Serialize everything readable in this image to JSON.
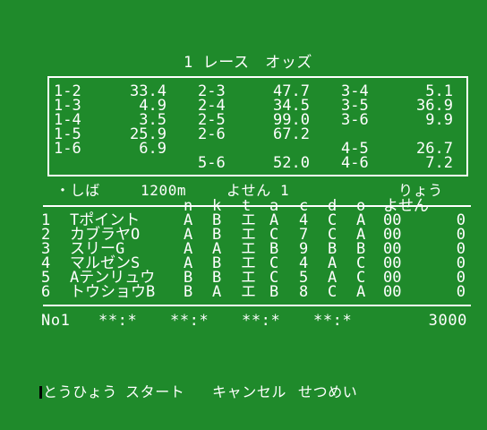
{
  "title": "1 レース　オッズ",
  "odds": {
    "col1": [
      {
        "pair": "1-2",
        "odds": "33.4"
      },
      {
        "pair": "1-3",
        "odds": "4.9"
      },
      {
        "pair": "1-4",
        "odds": "3.5"
      },
      {
        "pair": "1-5",
        "odds": "25.9"
      },
      {
        "pair": "1-6",
        "odds": "6.9"
      }
    ],
    "col2": [
      {
        "pair": "2-3",
        "odds": "47.7"
      },
      {
        "pair": "2-4",
        "odds": "34.5"
      },
      {
        "pair": "2-5",
        "odds": "99.0"
      },
      {
        "pair": "2-6",
        "odds": "67.2"
      },
      {
        "pair": "5-6",
        "odds": "52.0"
      }
    ],
    "col3": [
      {
        "pair": "3-4",
        "odds": "5.1"
      },
      {
        "pair": "3-5",
        "odds": "36.9"
      },
      {
        "pair": "3-6",
        "odds": "9.9"
      },
      {
        "pair": "4-5",
        "odds": "26.7"
      },
      {
        "pair": "4-6",
        "odds": "7.2"
      }
    ]
  },
  "race_info": {
    "surface": "・しば",
    "distance": "1200m",
    "type": "よせん 1",
    "right_label": "りょう"
  },
  "headers": [
    "n",
    "k",
    "t",
    "a",
    "c",
    "d",
    "o",
    "よせん"
  ],
  "horses": [
    {
      "no": "1",
      "name": "Tポイント",
      "n": "A",
      "k": "B",
      "t": "エ",
      "a": "A",
      "c": "4",
      "d": "C",
      "o": "A",
      "y": "00",
      "r": "0"
    },
    {
      "no": "2",
      "name": "カブラヤO",
      "n": "A",
      "k": "B",
      "t": "エ",
      "a": "C",
      "c": "7",
      "d": "C",
      "o": "A",
      "y": "00",
      "r": "0"
    },
    {
      "no": "3",
      "name": "スリーG",
      "n": "A",
      "k": "A",
      "t": "エ",
      "a": "B",
      "c": "9",
      "d": "B",
      "o": "B",
      "y": "00",
      "r": "0"
    },
    {
      "no": "4",
      "name": "マルゼンS",
      "n": "A",
      "k": "B",
      "t": "エ",
      "a": "C",
      "c": "4",
      "d": "A",
      "o": "C",
      "y": "00",
      "r": "0"
    },
    {
      "no": "5",
      "name": "Aテンリュウ",
      "n": "B",
      "k": "B",
      "t": "エ",
      "a": "C",
      "c": "5",
      "d": "A",
      "o": "C",
      "y": "00",
      "r": "0"
    },
    {
      "no": "6",
      "name": "トウショウB",
      "n": "B",
      "k": "A",
      "t": "エ",
      "a": "B",
      "c": "8",
      "d": "C",
      "o": "A",
      "y": "00",
      "r": "0"
    }
  ],
  "bet_line": {
    "label": "No1",
    "slots": [
      "**:*",
      "**:*",
      "**:*",
      "**:*"
    ],
    "money": "3000"
  },
  "menu": [
    "とうひょう",
    "スタート",
    "キャンセル",
    "せつめい"
  ],
  "colors": {
    "background": "#1f8a2b",
    "text": "#ffffff",
    "cursor": "#000000"
  }
}
